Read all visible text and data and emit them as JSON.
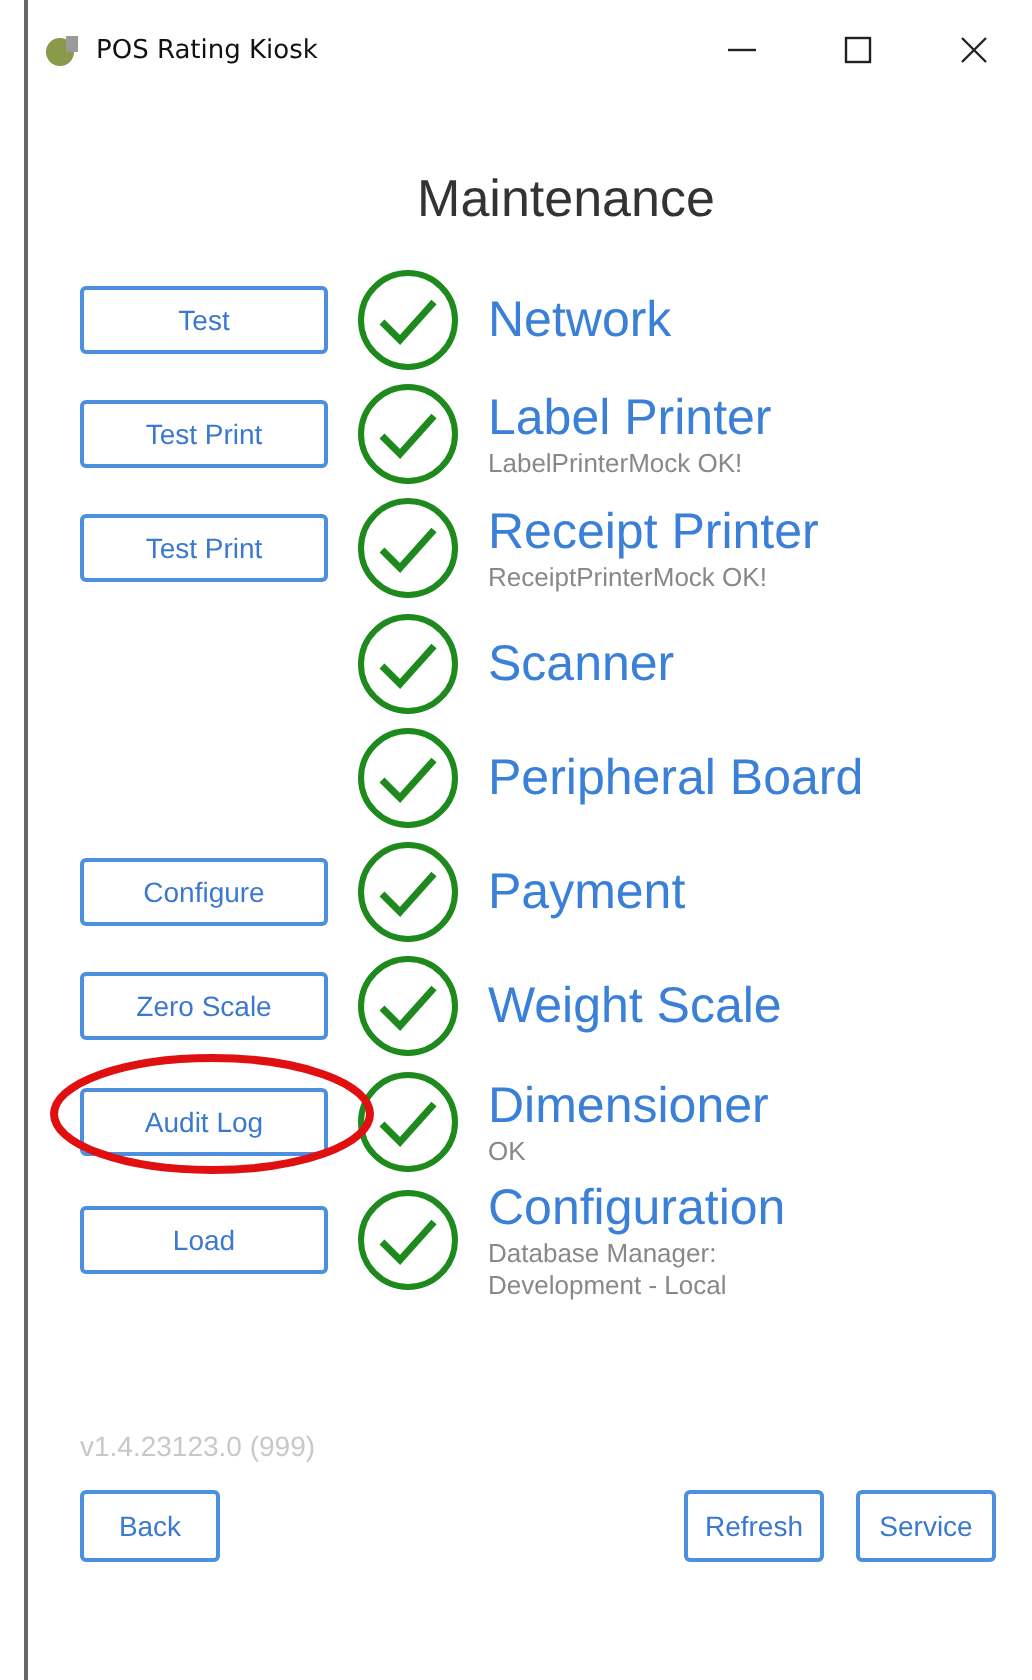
{
  "window": {
    "title": "POS Rating Kiosk"
  },
  "heading": "Maintenance",
  "rows": [
    {
      "button": "Test",
      "passed": true,
      "name": "Network",
      "circled": false
    },
    {
      "button": "Test Print",
      "passed": true,
      "name": "Label Printer",
      "detail": "LabelPrinterMock OK!",
      "circled": false
    },
    {
      "button": "Test Print",
      "passed": true,
      "name": "Receipt Printer",
      "detail": "ReceiptPrinterMock OK!",
      "circled": false
    },
    {
      "passed": true,
      "name": "Scanner",
      "circled": false
    },
    {
      "passed": true,
      "name": "Peripheral Board",
      "circled": false
    },
    {
      "button": "Configure",
      "passed": true,
      "name": "Payment",
      "circled": false
    },
    {
      "button": "Zero Scale",
      "passed": true,
      "name": "Weight Scale",
      "circled": false
    },
    {
      "button": "Audit Log",
      "passed": true,
      "name": "Dimensioner",
      "detail": "OK",
      "circled": true
    },
    {
      "button": "Load",
      "passed": true,
      "name": "Configuration",
      "detail": "Database Manager:\nDevelopment - Local",
      "circled": false
    }
  ],
  "version": "v1.4.23123.0 (999)",
  "footer": {
    "left": [
      "Back"
    ],
    "right": [
      "Refresh",
      "Service"
    ]
  }
}
